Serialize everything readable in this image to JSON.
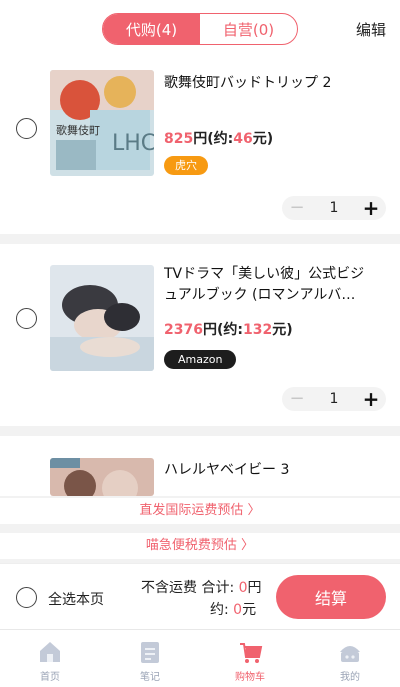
{
  "header": {
    "tabs": [
      {
        "label": "代购(4)",
        "active": true
      },
      {
        "label": "自营(0)",
        "active": false
      }
    ],
    "edit_label": "编辑"
  },
  "items": [
    {
      "title": "歌舞伎町バッドトリップ 2",
      "price_yen": "825",
      "price_sep": "円(约:",
      "price_cny": "46",
      "price_end": "元)",
      "tag": "虎穴",
      "quantity": "1"
    },
    {
      "title": "TVドラマ「美しい彼」公式ビジュアルブック (ロマンアルバ…",
      "price_yen": "2376",
      "price_sep": "円(约:",
      "price_cny": "132",
      "price_end": "元)",
      "tag": "Amazon",
      "quantity": "1"
    },
    {
      "title": "ハレルヤベイビー 3"
    }
  ],
  "notices": {
    "intl_shipping": "直发国际运费预估 〉",
    "tax": "喵急便税费预估 〉"
  },
  "checkout": {
    "select_all": "全选本页",
    "total_prefix": "不含运费 合计: ",
    "total_yen": "0",
    "total_yen_unit": "円",
    "approx_prefix": "约: ",
    "total_cny": "0",
    "total_cny_unit": "元",
    "settle_label": "结算"
  },
  "nav": {
    "items": [
      {
        "label": "首页",
        "icon": "home-icon",
        "active": false
      },
      {
        "label": "笔记",
        "icon": "notes-icon",
        "active": false
      },
      {
        "label": "购物车",
        "icon": "cart-icon",
        "active": true
      },
      {
        "label": "我的",
        "icon": "profile-icon",
        "active": false
      }
    ]
  },
  "colors": {
    "accent": "#f0626e",
    "tag_orange": "#f79a12",
    "tag_black": "#1d1d1d",
    "nav_inactive": "#9aa3b5"
  }
}
